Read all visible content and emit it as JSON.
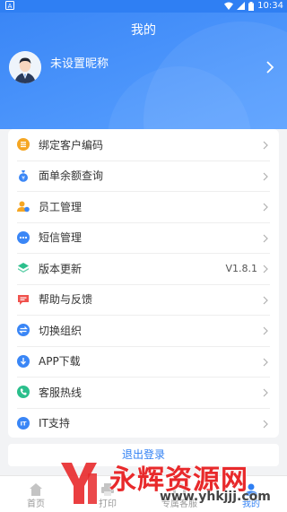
{
  "status_bar": {
    "time": "10:34"
  },
  "header": {
    "title": "我的",
    "nickname": "未设置昵称"
  },
  "menu": [
    {
      "label": "绑定客户编码",
      "icon": "list-icon",
      "color": "#f5a623"
    },
    {
      "label": "面单余额查询",
      "icon": "money-bag-icon",
      "color": "#3a86f6"
    },
    {
      "label": "员工管理",
      "icon": "staff-icon",
      "color": "#f5a623"
    },
    {
      "label": "短信管理",
      "icon": "chat-dots-icon",
      "color": "#3a86f6"
    },
    {
      "label": "版本更新",
      "icon": "layers-icon",
      "color": "#2bbf8c",
      "value": "V1.8.1"
    },
    {
      "label": "帮助与反馈",
      "icon": "feedback-icon",
      "color": "#f0524d"
    },
    {
      "label": "切换组织",
      "icon": "switch-icon",
      "color": "#3a86f6"
    },
    {
      "label": "APP下载",
      "icon": "download-icon",
      "color": "#3a86f6"
    },
    {
      "label": "客服热线",
      "icon": "phone-icon",
      "color": "#2bbf8c"
    },
    {
      "label": "IT支持",
      "icon": "it-support-icon",
      "color": "#3a86f6"
    }
  ],
  "logout_label": "退出登录",
  "tabs": [
    {
      "label": "首页",
      "icon": "home-icon"
    },
    {
      "label": "打印",
      "icon": "print-icon"
    },
    {
      "label": "专属客服",
      "icon": "service-icon"
    },
    {
      "label": "我的",
      "icon": "profile-icon",
      "active": true
    }
  ],
  "watermark": {
    "brand": "永辉资源网",
    "url": "www.yhkjjj.com"
  },
  "colors": {
    "accent": "#2f7ff3"
  }
}
